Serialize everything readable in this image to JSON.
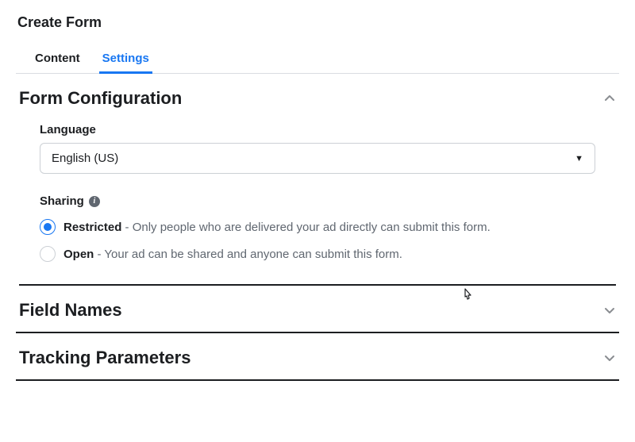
{
  "title": "Create Form",
  "tabs": {
    "content": "Content",
    "settings": "Settings"
  },
  "sections": {
    "formConfig": {
      "title": "Form Configuration",
      "language": {
        "label": "Language",
        "value": "English (US)"
      },
      "sharing": {
        "label": "Sharing",
        "options": {
          "restricted": {
            "name": "Restricted",
            "desc": " - Only people who are delivered your ad directly can submit this form."
          },
          "open": {
            "name": "Open",
            "desc": " - Your ad can be shared and anyone can submit this form."
          }
        }
      }
    },
    "fieldNames": {
      "title": "Field Names"
    },
    "trackingParams": {
      "title": "Tracking Parameters"
    }
  }
}
